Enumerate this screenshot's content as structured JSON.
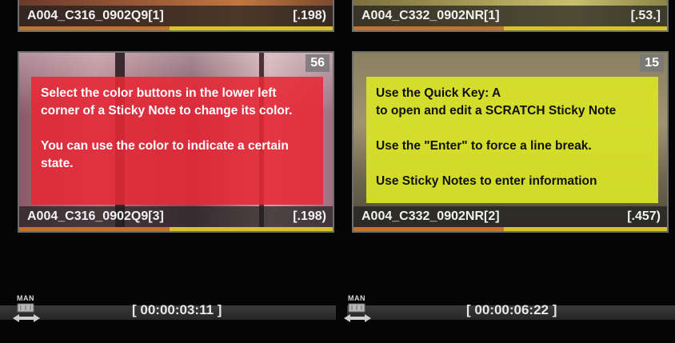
{
  "clips": [
    {
      "id": "top-left",
      "name": "A004_C316_0902Q9[1]",
      "value": "[.198)"
    },
    {
      "id": "top-right",
      "name": "A004_C332_0902NR[1]",
      "value": "[.53.]"
    },
    {
      "id": "red",
      "name": "A004_C316_0902Q9[3]",
      "value": "[.198)",
      "badge": "56",
      "sticky_color": "#e62837",
      "sticky_text": "Select the color buttons in the lower left\ncorner of a Sticky Note to change its color.\n\nYou can use the color to indicate a certain\nstate."
    },
    {
      "id": "yellow",
      "name": "A004_C332_0902NR[2]",
      "value": "[.457)",
      "badge": "15",
      "sticky_color": "#d7e128",
      "sticky_text": "Use the Quick Key: A\nto open and edit a SCRATCH Sticky Note\n\nUse the \"Enter\" to force a line break.\n\nUse Sticky Notes to enter information"
    }
  ],
  "timelines": [
    {
      "mode_label": "MAN",
      "timecode": "[ 00:00:03:11 ]"
    },
    {
      "mode_label": "MAN",
      "timecode": "[ 00:00:06:22 ]"
    }
  ]
}
